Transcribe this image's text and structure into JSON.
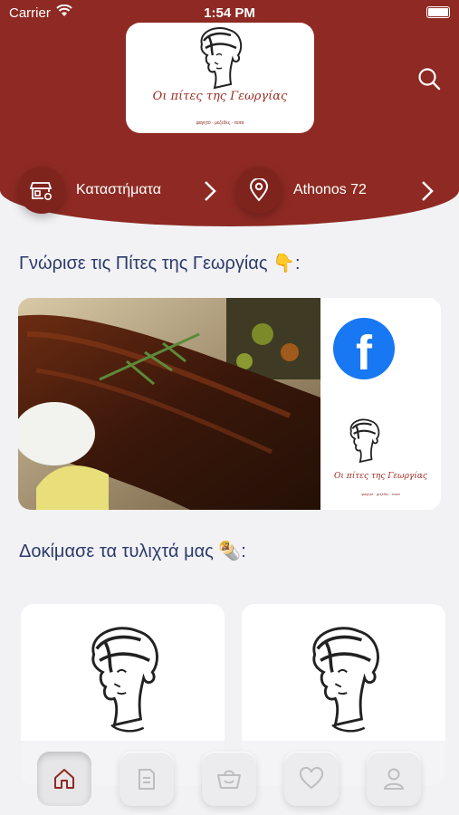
{
  "status_bar": {
    "carrier": "Carrier",
    "time": "1:54 PM"
  },
  "logo": {
    "name": "Οι πίτες της Γεωργίας",
    "tagline": "φαγητό · μεζέδες · ποτά"
  },
  "header": {
    "stores_label": "Καταστήματα",
    "address_label": "Athonos 72"
  },
  "sections": {
    "meet_title": "Γνώρισε τις Πίτες της Γεωργίας 👇:",
    "wraps_title": "Δοκίμασε τα τυλιχτά μας 🌯:"
  },
  "banner": {
    "facebook_glyph": "f"
  },
  "icons": {
    "search": "search-icon",
    "stores": "store-icon",
    "location": "location-pin-icon",
    "home": "home-icon",
    "menu": "menu-icon",
    "cart": "basket-icon",
    "favorites": "heart-icon",
    "profile": "user-icon"
  },
  "colors": {
    "brand": "#8e2a23",
    "title": "#2c3a6b",
    "facebook": "#1877f2",
    "tab_active_icon": "#8e2a23"
  }
}
